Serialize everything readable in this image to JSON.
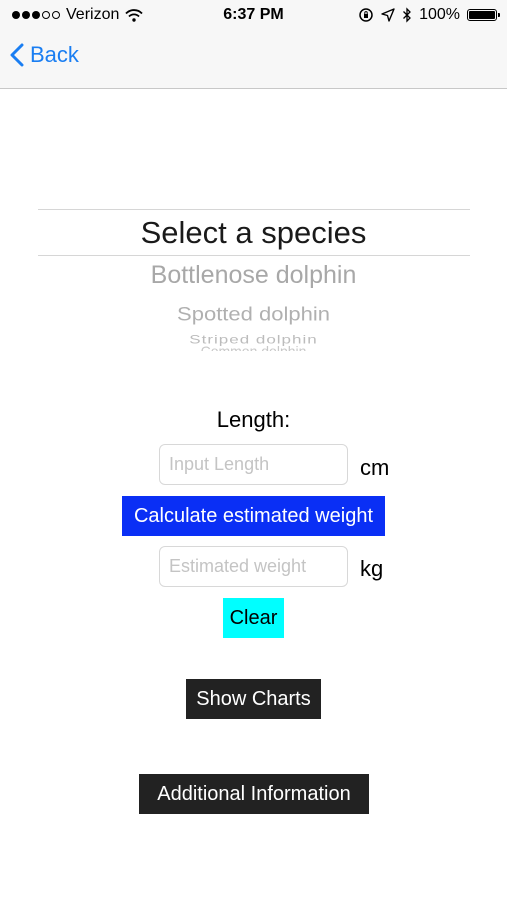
{
  "status_bar": {
    "carrier": "Verizon",
    "time": "6:37 PM",
    "battery": "100%",
    "battery_level": 1.0,
    "signal_bars_filled": 3,
    "signal_bars_total": 5
  },
  "nav": {
    "back_label": "Back"
  },
  "picker": {
    "title": "Select a species",
    "options": [
      "Bottlenose dolphin",
      "Spotted dolphin",
      "Striped dolphin",
      "Common dolphin"
    ]
  },
  "form": {
    "length_label": "Length:",
    "length_placeholder": "Input Length",
    "length_unit": "cm",
    "calculate_label": "Calculate estimated weight",
    "weight_placeholder": "Estimated weight",
    "weight_unit": "kg",
    "clear_label": "Clear"
  },
  "buttons": {
    "show_charts": "Show Charts",
    "additional_info": "Additional Information"
  },
  "colors": {
    "accent": "#1a7ef2",
    "calculate_bg": "#0a2ff5",
    "clear_bg": "#00ffff",
    "dark_button_bg": "#222222"
  }
}
